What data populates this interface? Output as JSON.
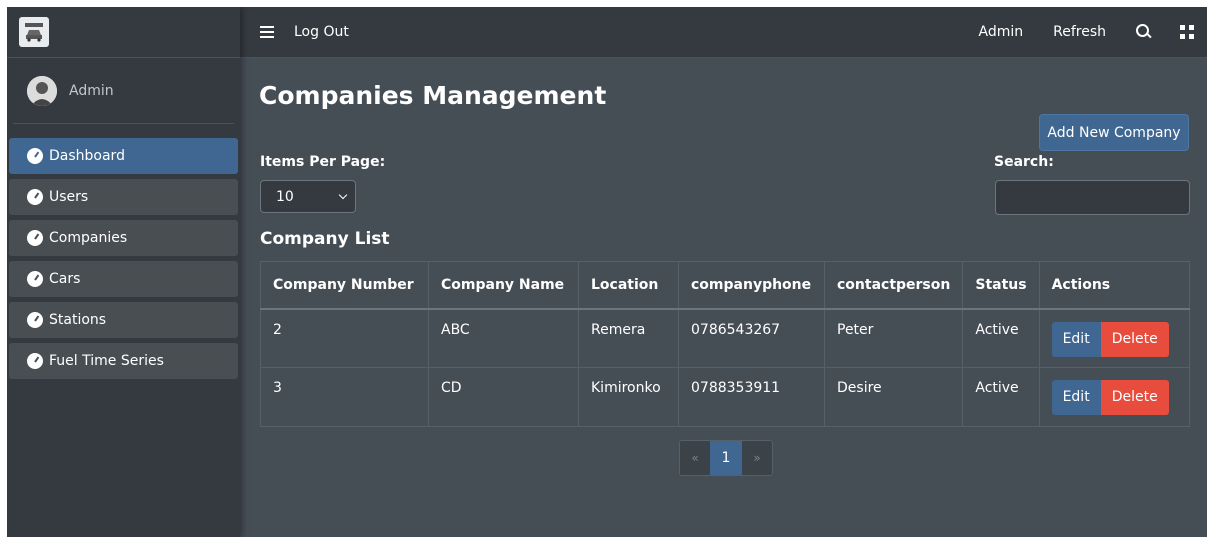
{
  "brand": {
    "logo_icon": "car-garage-icon"
  },
  "user": {
    "name": "Admin",
    "avatar_icon": "user-avatar-icon"
  },
  "sidebar": {
    "items": [
      {
        "label": "Dashboard",
        "icon": "tachometer-icon",
        "active": true
      },
      {
        "label": "Users",
        "icon": "tachometer-icon",
        "active": false
      },
      {
        "label": "Companies",
        "icon": "tachometer-icon",
        "active": false
      },
      {
        "label": "Cars",
        "icon": "tachometer-icon",
        "active": false
      },
      {
        "label": "Stations",
        "icon": "tachometer-icon",
        "active": false
      },
      {
        "label": "Fuel Time Series",
        "icon": "tachometer-icon",
        "active": false
      }
    ]
  },
  "topbar": {
    "menu_icon": "hamburger-menu-icon",
    "logout": "Log Out",
    "admin": "Admin",
    "refresh": "Refresh",
    "search_icon": "search-icon",
    "fullscreen_icon": "expand-icon"
  },
  "main": {
    "title": "Companies Management",
    "add_button": "Add New Company",
    "items_per_page_label": "Items Per Page:",
    "items_per_page_value": "10",
    "search_label": "Search:",
    "search_value": "",
    "list_title": "Company List",
    "table": {
      "headers": [
        "Company Number",
        "Company Name",
        "Location",
        "companyphone",
        "contactperson",
        "Status",
        "Actions"
      ],
      "rows": [
        {
          "number": "2",
          "name": "ABC",
          "location": "Remera",
          "phone": "0786543267",
          "contact": "Peter",
          "status": "Active"
        },
        {
          "number": "3",
          "name": "CD",
          "location": "Kimironko",
          "phone": "0788353911",
          "contact": "Desire",
          "status": "Active"
        }
      ],
      "edit_label": "Edit",
      "delete_label": "Delete"
    },
    "pagination": {
      "prev": "«",
      "current": "1",
      "next": "»"
    }
  },
  "colors": {
    "sidebar_bg": "#343a40",
    "content_bg": "#454d55",
    "primary": "#3f6791",
    "danger": "#e74c3c"
  }
}
